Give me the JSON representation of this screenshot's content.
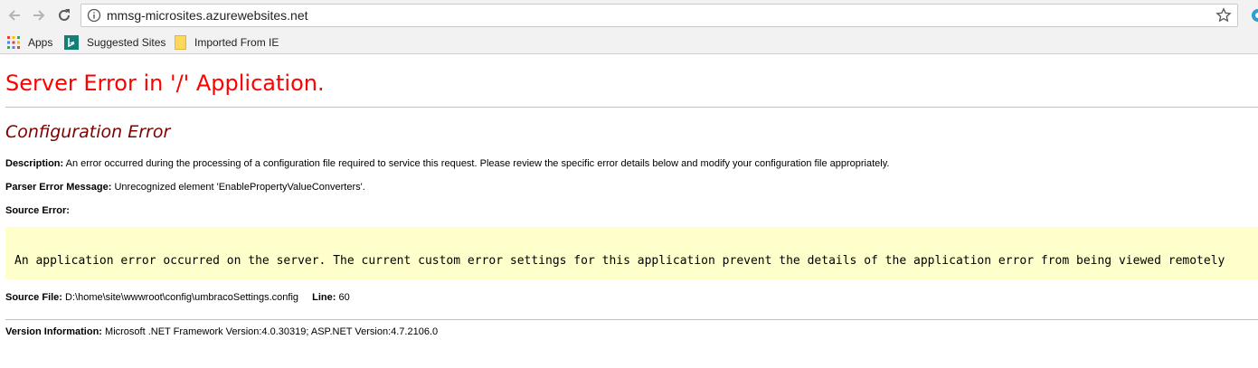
{
  "browser": {
    "url": "mmsg-microsites.azurewebsites.net",
    "bookmarks": [
      "Apps",
      "Suggested Sites",
      "Imported From IE"
    ],
    "colors": {
      "chrome": "#f2f2f2"
    }
  },
  "page": {
    "title": "Server Error in '/' Application.",
    "subtitle": "Configuration Error",
    "description_label": "Description:",
    "description_text": "An error occurred during the processing of a configuration file required to service this request. Please review the specific error details below and modify your configuration file appropriately.",
    "parser_label": "Parser Error Message:",
    "parser_text": "Unrecognized element 'EnablePropertyValueConverters'.",
    "source_error_label": "Source Error:",
    "source_error_text": "An application error occurred on the server. The current custom error settings for this application prevent the details of the application error from being viewed remotely",
    "source_file_label": "Source File:",
    "source_file_value": "D:\\home\\site\\wwwroot\\config\\umbracoSettings.config",
    "line_label": "Line:",
    "line_value": "60",
    "version_label": "Version Information:",
    "version_text": "Microsoft .NET Framework Version:4.0.30319; ASP.NET Version:4.7.2106.0",
    "colors": {
      "title": "#ff0000",
      "subtitle": "#800000",
      "source_box": "#ffffcc"
    }
  }
}
